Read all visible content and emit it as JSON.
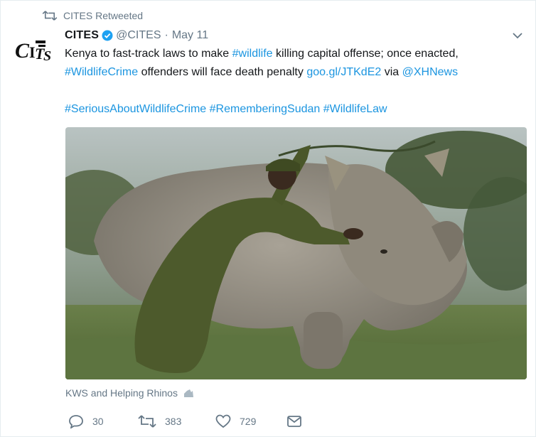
{
  "retweet_banner": {
    "text": "CITES Retweeted",
    "icon": "retweet-icon"
  },
  "author": {
    "name": "CITES",
    "handle": "@CITES",
    "separator": "·",
    "date": "May 11",
    "verified": true,
    "avatar_logo": "CITES",
    "verified_color": "#1da1f2"
  },
  "tweet": {
    "part1": "Kenya to fast-track laws to make ",
    "hashtag_wildlife": "#wildlife",
    "part2": " killing capital offense; once enacted,",
    "hashtag_wildlifecrime": "#WildlifeCrime",
    "part3": " offenders will face death penalty ",
    "link": "goo.gl/JTKdE2",
    "part4": " via ",
    "mention": "@XHNews",
    "hashtag_serious": "#SeriousAboutWildlifeCrime",
    "hashtag_remembering": "#RememberingSudan",
    "hashtag_law": "#WildlifeLaw",
    "link_color": "#1b95e0"
  },
  "media": {
    "description_icon": "photo-of-ranger-and-rhino",
    "tagged_users": "KWS and Helping Rhinos",
    "tag_icon": "tagged-people-icon"
  },
  "actions": {
    "reply_count": "30",
    "retweet_count": "383",
    "like_count": "729",
    "reply_icon": "reply-icon",
    "retweet_icon": "retweet-icon",
    "like_icon": "heart-icon",
    "dm_icon": "envelope-icon"
  }
}
